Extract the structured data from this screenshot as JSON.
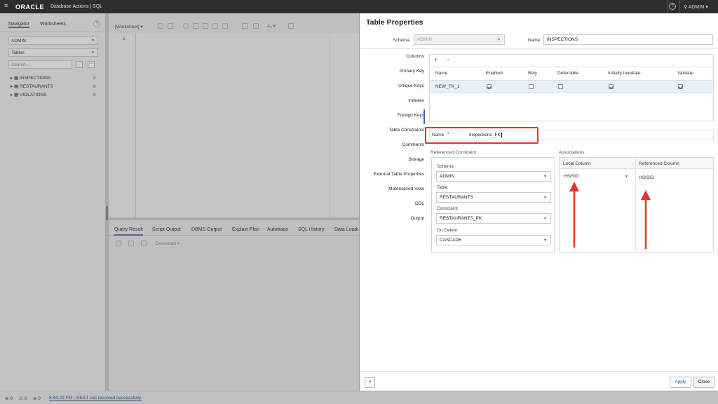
{
  "topbar": {
    "menu_glyph": "≡",
    "logo": "ORACLE",
    "product": "Database Actions | SQL",
    "help_glyph": "?",
    "user": "ADMIN ▾"
  },
  "navigator": {
    "tabs": [
      "Navigator",
      "Worksheets"
    ],
    "schema": "ADMIN",
    "object_type": "Tables",
    "search_placeholder": "Search...",
    "tables": [
      "INSPECTIONS",
      "RESTAURANTS",
      "VIOLATIONS"
    ]
  },
  "worksheet": {
    "label": "[Worksheet]",
    "line_number": "1",
    "output_tabs": [
      "Query Result",
      "Script Output",
      "DBMS Output",
      "Explain Plan",
      "Autotrace",
      "SQL History",
      "Data Loadi"
    ],
    "download": "Download ▾"
  },
  "status": {
    "errors": "0",
    "warnings": "0",
    "info": "0",
    "message": "8:44:29 PM - REST call resolved successfully."
  },
  "dialog": {
    "title": "Table Properties",
    "schema_label": "Schema",
    "schema_value": "ADMIN",
    "name_label": "Name",
    "name_value": "INSPECTIONS",
    "sidebar": [
      "Columns",
      "Primary Key",
      "Unique Keys",
      "Indexes",
      "Foreign Keys",
      "Table Constraints",
      "Comments",
      "Storage",
      "External Table Properties",
      "Materialized View",
      "DDL",
      "Output"
    ],
    "fk_toolbar": {
      "add": "+",
      "remove": "−"
    },
    "fk_columns": [
      "Name",
      "Enabled",
      "Rely",
      "Deferrable",
      "Initially Imediate",
      "Validate"
    ],
    "fk_row": {
      "name": "NEW_FK_1",
      "enabled": true,
      "rely": false,
      "deferrable": false,
      "initially_immediate": true,
      "validate": true
    },
    "fk_name_label": "Name",
    "fk_name_required": "*",
    "fk_name_value": "Inspections_FK",
    "referenced_constraint": {
      "heading": "Referenced Constraint",
      "schema_label": "Schema",
      "schema_value": "ADMIN",
      "table_label": "Table",
      "table_value": "RESTAURANTS",
      "constraint_label": "Constraint",
      "constraint_value": "RESTAURANTS_PK",
      "on_delete_label": "On Delete",
      "on_delete_value": "CASCADE"
    },
    "associations": {
      "heading": "Associations",
      "local_column_header": "Local Column",
      "referenced_column_header": "Referenced Column",
      "local_value": "HSISID",
      "referenced_value": "HSISID"
    },
    "help_glyph": "?",
    "apply": "Apply",
    "close": "Close"
  },
  "colors": {
    "highlight": "#e2352c",
    "accent": "#3a6fb0",
    "selected_row": "#e8f1fb"
  }
}
